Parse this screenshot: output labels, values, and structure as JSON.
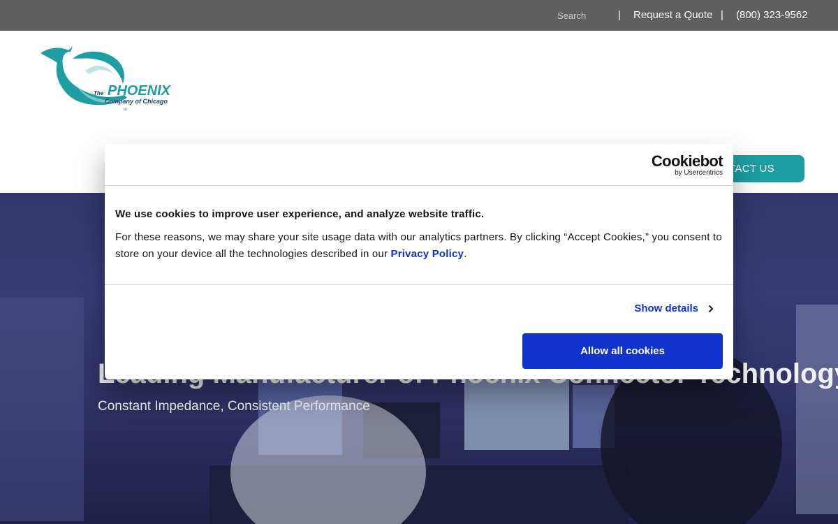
{
  "topbar": {
    "search_placeholder": "Search",
    "separator": "|",
    "request_quote": "Request a Quote",
    "phone": "(800) 323-9562"
  },
  "header": {
    "logo": {
      "the": "The",
      "name": "PHOENIX",
      "tagline": "Company of Chicago",
      "tm": "TM"
    },
    "contact_label": "CONTACT US",
    "accent_color": "#1c9ea3"
  },
  "hero": {
    "title": "Leading Manufacturer of Phoenix Connector Technology",
    "subtitle": "Constant Impedance, Consistent Performance"
  },
  "cookie_dialog": {
    "brand": "Cookiebot",
    "brand_by": "by Usercentrics",
    "heading": "We use cookies to improve user experience, and analyze website traffic.",
    "body_text": "For these reasons, we may share your site usage data with our analytics partners. By clicking “Accept Cookies,” you consent to store on your device all the technologies described in our",
    "policy_link": "Privacy Policy",
    "body_end": ".",
    "show_details": "Show details",
    "allow_all": "Allow all cookies",
    "button_color": "#1032cf"
  }
}
